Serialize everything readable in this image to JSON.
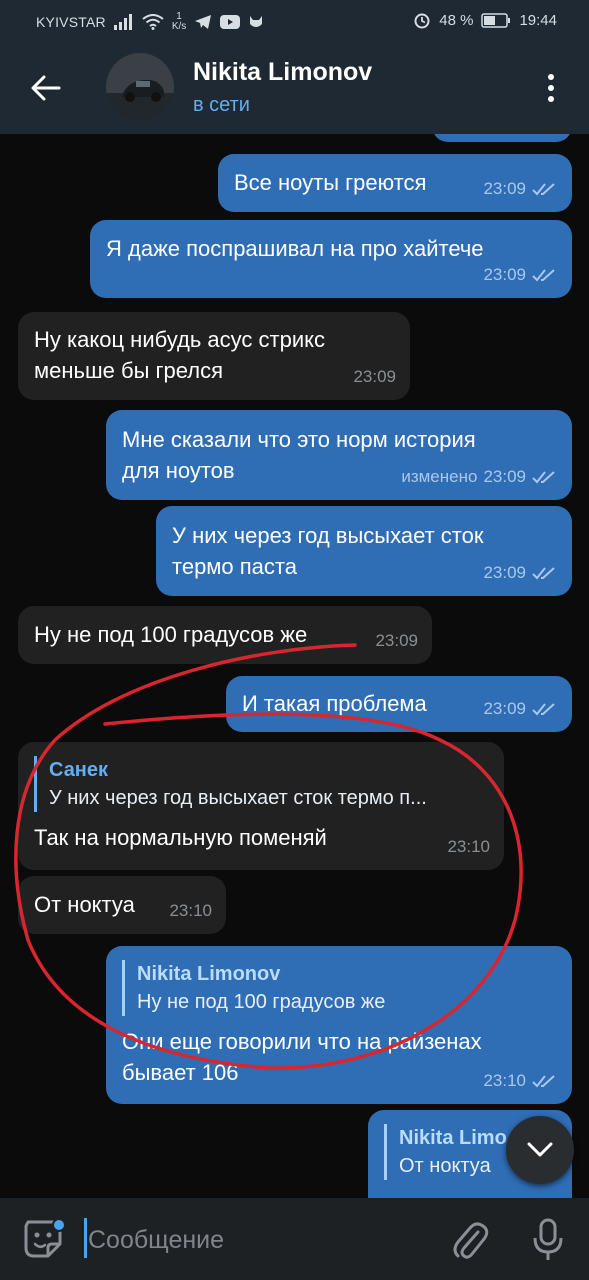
{
  "status_bar": {
    "carrier": "KYIVSTAR",
    "speed_value": "1",
    "speed_unit": "K/s",
    "battery": "48 %",
    "time": "19:44"
  },
  "header": {
    "name": "Nikita Limonov",
    "status": "в сети"
  },
  "messages": [
    {
      "dir": "out",
      "text": "Все ноуты греются",
      "time": "23:09",
      "edited": ""
    },
    {
      "dir": "out",
      "text": "Я даже поспрашивал на про хайтече",
      "time": "23:09",
      "edited": ""
    },
    {
      "dir": "in",
      "text": "Ну какоц нибудь асус стрикс\nменьше бы грелся",
      "time": "23:09",
      "edited": ""
    },
    {
      "dir": "out",
      "text": "Мне сказали что это норм история\nдля ноутов",
      "time": "23:09",
      "edited": "изменено"
    },
    {
      "dir": "out",
      "text": "У них через год высыхает сток\nтермо паста",
      "time": "23:09",
      "edited": ""
    },
    {
      "dir": "in",
      "text": "Ну не под 100 градусов же",
      "time": "23:09",
      "edited": ""
    },
    {
      "dir": "out",
      "text": "И такая проблема",
      "time": "23:09",
      "edited": ""
    },
    {
      "dir": "in",
      "reply_name": "Санек",
      "reply_text": "У них через год высыхает сток термо п...",
      "text": "Так на нормальную поменяй",
      "time": "23:10",
      "edited": ""
    },
    {
      "dir": "in",
      "text": "От ноктуа",
      "time": "23:10",
      "edited": ""
    },
    {
      "dir": "out",
      "reply_name": "Nikita Limonov",
      "reply_text": "Ну не под 100 градусов же",
      "text": "Они еще говорили что на райзенах\nбывает 106",
      "time": "23:10",
      "edited": ""
    },
    {
      "dir": "out",
      "reply_name": "Nikita Limo",
      "reply_text": "От ноктуа",
      "text": "",
      "time": "",
      "edited": ""
    }
  ],
  "input": {
    "placeholder": "Сообщение"
  },
  "colors": {
    "outgoing_bubble": "#2f6db5",
    "incoming_bubble": "#212121",
    "accent": "#64aef0",
    "annotation": "#d8262f"
  },
  "icons": {
    "back": "arrow-left-icon",
    "menu": "more-vertical-icon",
    "emoji": "sticker-icon",
    "attach": "paperclip-icon",
    "mic": "microphone-icon",
    "scroll_down": "chevron-down-icon"
  }
}
